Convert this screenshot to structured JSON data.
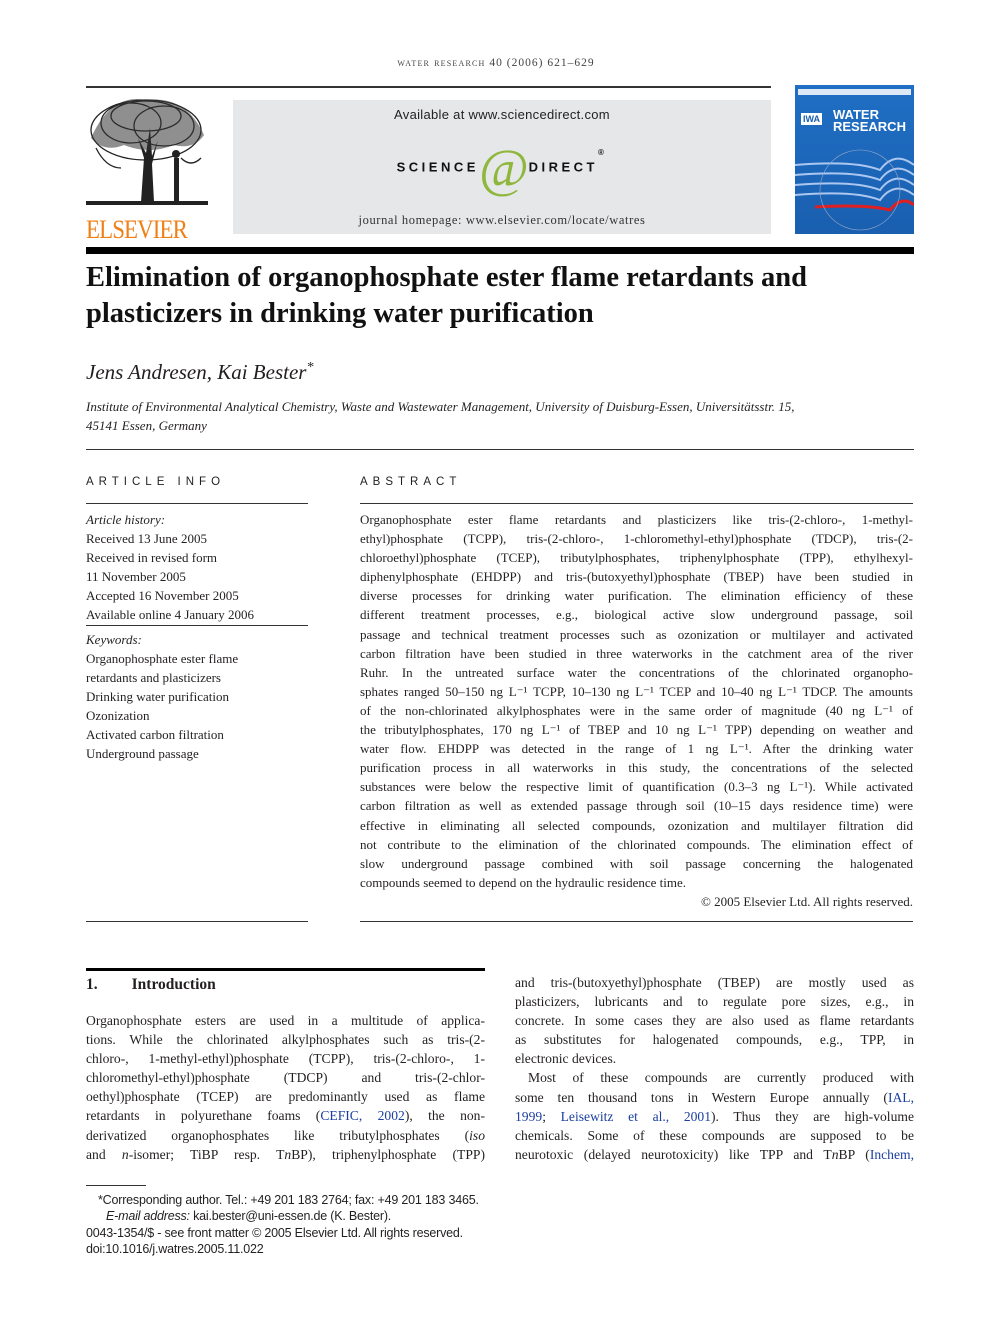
{
  "header": {
    "journal_name": "water research",
    "citation": "40 (2006) 621–629"
  },
  "banner": {
    "available": "Available at www.sciencedirect.com",
    "logo_left": "SCIENCE",
    "logo_at": "@",
    "logo_right": "DIRECT",
    "logo_reg": "®",
    "homepage": "journal homepage: www.elsevier.com/locate/watres"
  },
  "publisher_logo": "ELSEVIER",
  "cover": {
    "badge": "IWA",
    "title1": "WATER",
    "title2": "RESEARCH"
  },
  "colors": {
    "elsevier_orange": "#f07f16",
    "sciencedirect_green": "#8fb73e",
    "cover_blue": "#1f6fc4",
    "link_blue": "#1b3fa0"
  },
  "article": {
    "title": [
      "Elimination of organophosphate ester flame retardants and",
      "plasticizers in drinking water purification"
    ],
    "authors": "Jens Andresen, Kai Bester",
    "author_mark": "*",
    "affiliation": [
      "Institute of Environmental Analytical Chemistry, Waste and Wastewater Management, University of Duisburg-Essen, Universitätsstr. 15,",
      "45141 Essen, Germany"
    ]
  },
  "article_info": {
    "heading": "ARTICLE INFO",
    "history_label": "Article history:",
    "history": [
      "Received 13 June 2005",
      "Received in revised form",
      "11 November 2005",
      "Accepted 16 November 2005",
      "Available online 4 January 2006"
    ],
    "keywords_label": "Keywords:",
    "keywords": [
      "Organophosphate ester flame",
      "retardants and plasticizers",
      "Drinking water purification",
      "Ozonization",
      "Activated carbon filtration",
      "Underground passage"
    ]
  },
  "abstract": {
    "heading": "ABSTRACT",
    "lines": [
      "Organophosphate ester flame retardants and plasticizers like tris-(2-chloro-, 1-methyl-",
      "ethyl)phosphate (TCPP), tris-(2-chloro-, 1-chloromethyl-ethyl)phosphate (TDCP), tris-(2-",
      "chloroethyl)phosphate (TCEP), tributylphosphates, triphenylphosphate (TPP), ethylhexyl-",
      "diphenylphosphate (EHDPP) and tris-(butoxyethyl)phosphate (TBEP) have been studied in",
      "diverse processes for drinking water purification. The elimination efficiency of these",
      "different treatment processes, e.g., biological active slow underground passage, soil",
      "passage and technical treatment processes such as ozonization or multilayer and activated",
      "carbon filtration have been studied in three waterworks in the catchment area of the river",
      "Ruhr. In the untreated surface water the concentrations of the chlorinated organopho-",
      "sphates ranged 50–150 ng L⁻¹ TCPP, 10–130 ng L⁻¹ TCEP and 10–40 ng L⁻¹ TDCP. The amounts",
      "of the non-chlorinated alkylphosphates were in the same order of magnitude (40 ng L⁻¹ of",
      "the tributylphosphates, 170 ng L⁻¹ of TBEP and 10 ng L⁻¹ TPP) depending on weather and",
      "water flow. EHDPP was detected in the range of 1 ng L⁻¹. After the drinking water",
      "purification process in all waterworks in this study, the concentrations of the selected",
      "substances were below the respective limit of quantification (0.3–3 ng L⁻¹). While activated",
      "carbon filtration as well as extended passage through soil (10–15 days residence time) were",
      "effective in eliminating all selected compounds, ozonization and multilayer filtration did",
      "not contribute to the elimination of the chlorinated compounds. The elimination effect of",
      "slow underground passage combined with soil passage concerning the halogenated",
      "compounds seemed to depend on the hydraulic residence time."
    ],
    "copyright": "© 2005 Elsevier Ltd. All rights reserved."
  },
  "introduction": {
    "number": "1.",
    "title": "Introduction",
    "left_lines": [
      [
        {
          "t": "Organophosphate esters are used in a multitude of applica-"
        }
      ],
      [
        {
          "t": "tions. While the chlorinated alkylphosphates such as tris-(2-"
        }
      ],
      [
        {
          "t": "chloro-, 1-methyl-ethyl)phosphate (TCPP), tris-(2-chloro-, 1-"
        }
      ],
      [
        {
          "t": "chloromethyl-ethyl)phosphate (TDCP) and tris-(2-chlor-"
        }
      ],
      [
        {
          "t": "oethyl)phosphate (TCEP) are predominantly used as flame"
        }
      ],
      [
        {
          "t": "retardants in polyurethane foams ("
        },
        {
          "t": "CEFIC, 2002",
          "link": true
        },
        {
          "t": "), the non-"
        }
      ],
      [
        {
          "t": "derivatized organophosphates like tributylphosphates ("
        },
        {
          "t": "iso",
          "i": true
        }
      ],
      [
        {
          "t": "and "
        },
        {
          "t": "n",
          "i": true
        },
        {
          "t": "-isomer; TiBP resp. T"
        },
        {
          "t": "n",
          "i": true
        },
        {
          "t": "BP), triphenylphosphate (TPP)"
        }
      ]
    ],
    "right_lines": [
      [
        {
          "t": "and tris-(butoxyethyl)phosphate (TBEP) are mostly used as"
        }
      ],
      [
        {
          "t": "plasticizers, lubricants and to regulate pore sizes, e.g., in"
        }
      ],
      [
        {
          "t": "concrete. In some cases they are also used as flame retardants"
        }
      ],
      [
        {
          "t": "as substitutes for halogenated compounds, e.g., TPP, in"
        }
      ],
      [
        {
          "t": "electronic devices."
        }
      ],
      [
        {
          "t": "Most of these compounds are currently produced with"
        }
      ],
      [
        {
          "t": "some ten thousand tons in Western Europe annually ("
        },
        {
          "t": "IAL,",
          "link": true
        }
      ],
      [
        {
          "t": "1999",
          "link": true
        },
        {
          "t": "; "
        },
        {
          "t": "Leisewitz et al., 2001",
          "link": true
        },
        {
          "t": "). Thus they are high-volume"
        }
      ],
      [
        {
          "t": "chemicals. Some of these compounds are supposed to be"
        }
      ],
      [
        {
          "t": "neurotoxic (delayed neurotoxicity) like TPP and T"
        },
        {
          "t": "n",
          "i": true
        },
        {
          "t": "BP ("
        },
        {
          "t": "Inchem,",
          "link": true
        }
      ]
    ]
  },
  "footnotes": {
    "corresponding": "*Corresponding author. Tel.: +49 201 183 2764; fax: +49 201 183 3465.",
    "email_label": "E-mail address:",
    "email": " kai.bester@uni-essen.de (K. Bester).",
    "front_matter": "0043-1354/$ - see front matter © 2005 Elsevier Ltd. All rights reserved.",
    "doi": "doi:10.1016/j.watres.2005.11.022"
  }
}
